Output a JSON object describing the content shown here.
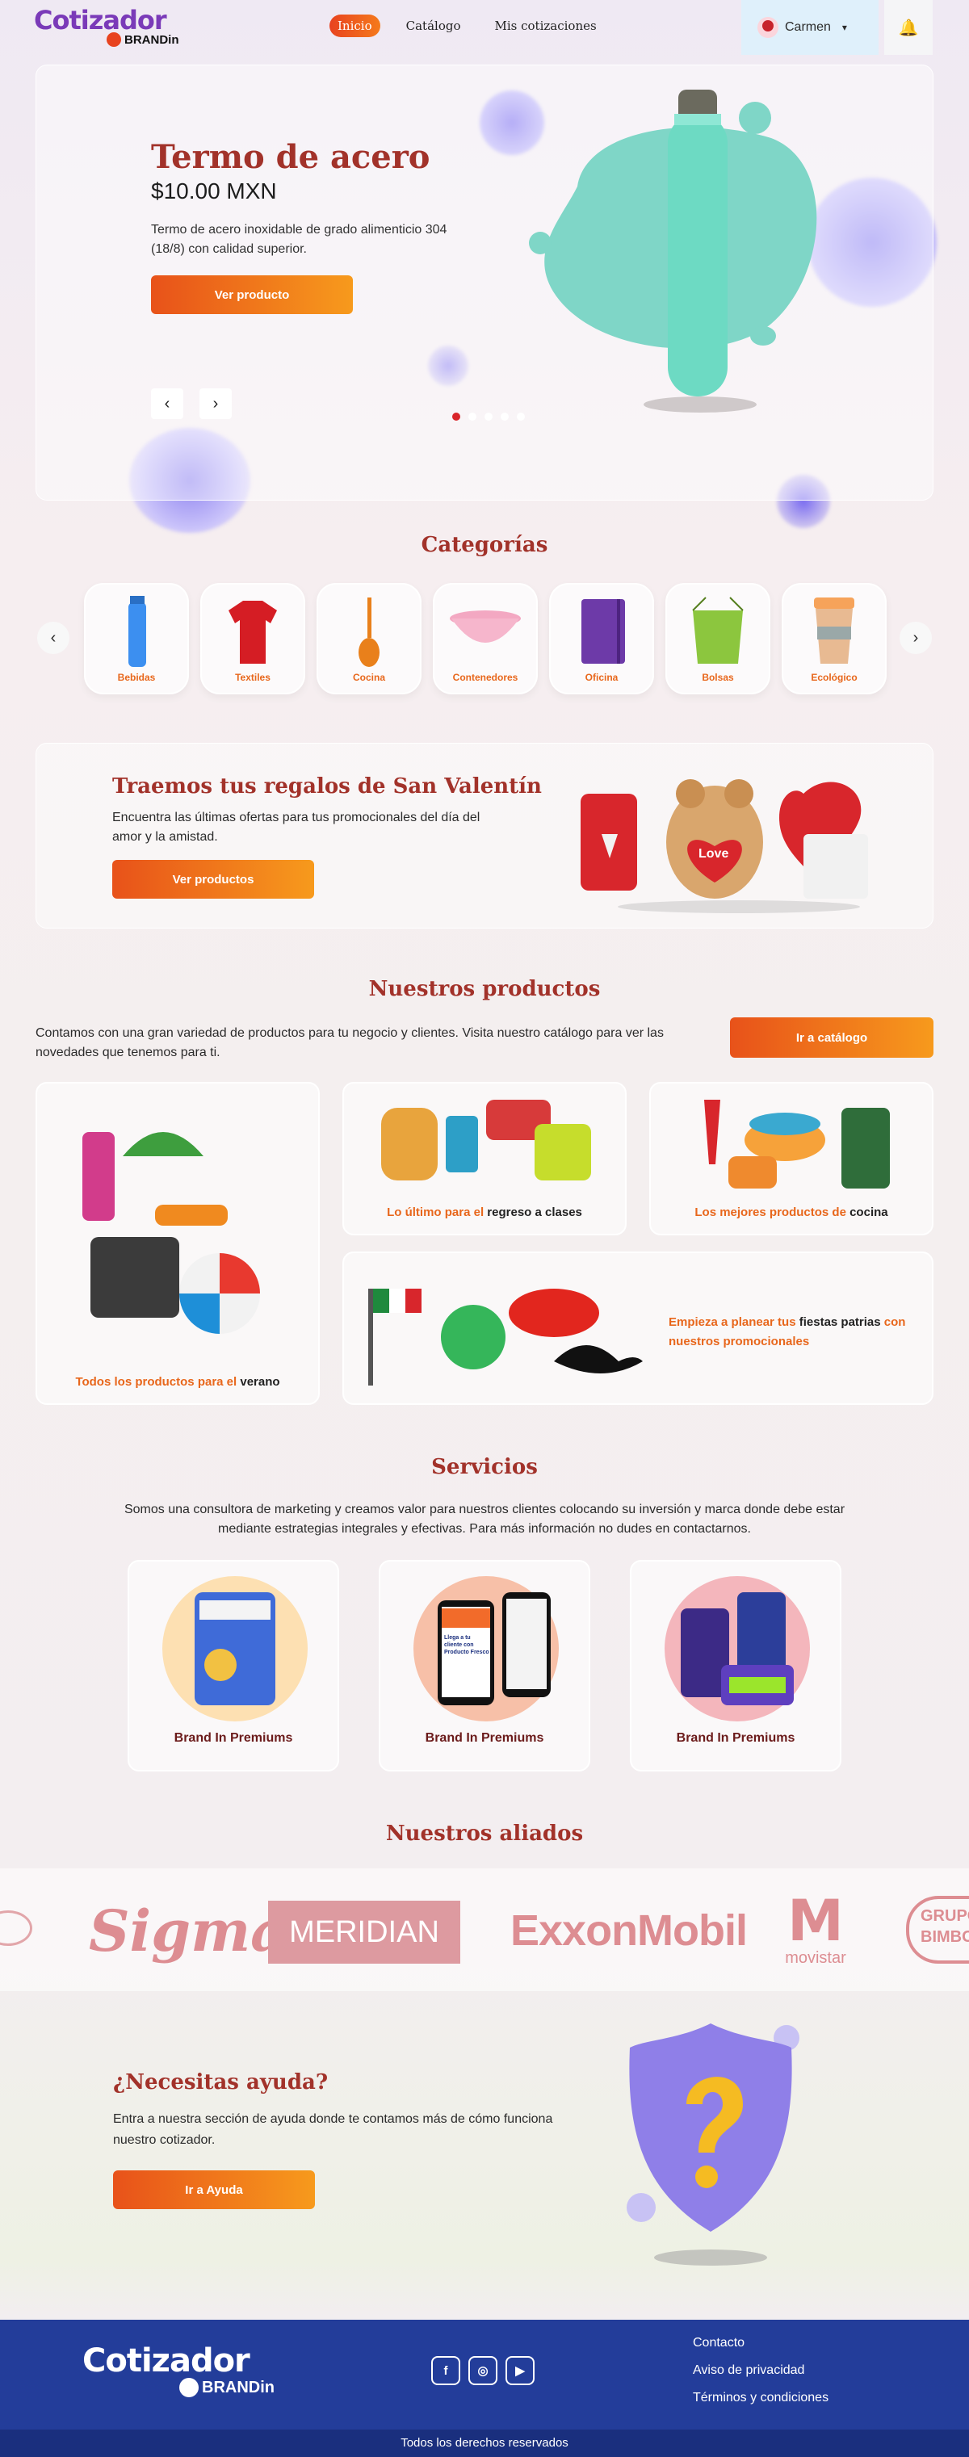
{
  "header": {
    "logo_main": "Cotizador",
    "logo_sub": "BRANDin",
    "nav": [
      "Inicio",
      "Catálogo",
      "Mis cotizaciones"
    ],
    "user_name": "Carmen",
    "chevron": "chevron-down-icon",
    "bell": "bell-icon"
  },
  "hero": {
    "title": "Termo de acero",
    "price": "$10.00 MXN",
    "description": "Termo de acero inoxidable de grado alimenticio 304 (18/8) con calidad superior.",
    "button": "Ver producto",
    "prev": "‹",
    "next": "›",
    "slides": 5,
    "active_slide": 1
  },
  "categories": {
    "title": "Categorías",
    "items": [
      "Bebidas",
      "Textiles",
      "Cocina",
      "Contenedores",
      "Oficina",
      "Bolsas",
      "Ecológico"
    ],
    "prev": "‹",
    "next": "›"
  },
  "promo": {
    "title": "Traemos tus regalos de San Valentín",
    "description": "Encuentra las últimas ofertas para tus promocionales del día del amor y la amistad.",
    "button": "Ver productos",
    "heart_text": "Love"
  },
  "products": {
    "title": "Nuestros productos",
    "intro": "Contamos con una gran variedad de productos para tu negocio y clientes. Visita nuestro catálogo para ver las novedades que tenemos para ti.",
    "button": "Ir a catálogo",
    "cards": [
      {
        "pre": "Todos los productos para el ",
        "bold": "verano"
      },
      {
        "pre": "Lo último para el ",
        "bold": "regreso a clases"
      },
      {
        "pre": "Los mejores productos de ",
        "bold": "cocina"
      },
      {
        "pre": "Empieza a planear tus ",
        "bold": "fiestas patrias",
        "post": " con nuestros promocionales"
      }
    ]
  },
  "services": {
    "title": "Servicios",
    "text": "Somos una consultora de marketing y creamos  valor para nuestros clientes colocando su inversión y marca donde debe estar mediante estrategias integrales y efectivas. Para más información no dudes en contactarnos.",
    "cards": [
      "Brand In Premiums",
      "Brand In Premiums",
      "Brand In Premiums"
    ],
    "phone_text": "Llega a tu cliente con Producto Fresco"
  },
  "allies": {
    "title": "Nuestros  aliados",
    "logos": [
      "Sigma",
      "MERIDIAN",
      "ExxonMobil",
      "movistar",
      "GRUPO BIMBO"
    ]
  },
  "help": {
    "title": "¿Necesitas ayuda?",
    "description": "Entra a nuestra sección de ayuda donde te contamos más de cómo funciona nuestro cotizador.",
    "button": "Ir a Ayuda"
  },
  "footer": {
    "logo_main": "Cotizador",
    "logo_sub": "BRANDin",
    "socials": [
      "facebook-icon",
      "instagram-icon",
      "youtube-icon"
    ],
    "links": [
      "Contacto",
      "Aviso de privacidad",
      "Términos y condiciones"
    ],
    "copyright": "Todos los derechos reservados"
  }
}
